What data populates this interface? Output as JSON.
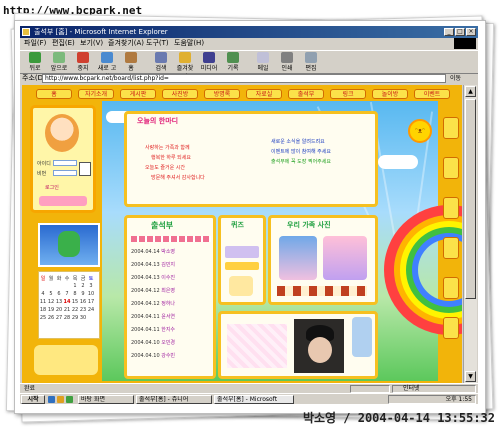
{
  "watermark_top": "http://www.bcpark.net",
  "watermark_bottom": "박소영 / 2004-04-14 13:55:32",
  "window": {
    "title": "출석부 [홈] - Microsoft Internet Explorer",
    "menu": [
      "파일(F)",
      "편집(E)",
      "보기(V)",
      "즐겨찾기(A)",
      "도구(T)",
      "도움말(H)"
    ],
    "toolbar": [
      "뒤로",
      "앞으로",
      "중지",
      "새로 고침",
      "홈",
      "검색",
      "즐겨찾기",
      "미디어",
      "기록",
      "메일",
      "인쇄",
      "편집"
    ],
    "address_label": "주소(D)",
    "address_value": "http://www.bcpark.net/board/list.php?id=",
    "go_label": "이동",
    "links_label": "연결"
  },
  "page": {
    "nav": [
      "홈",
      "자기소개",
      "게시판",
      "사진방",
      "방명록",
      "자료실",
      "출석부",
      "링크",
      "놀이방",
      "이벤트"
    ],
    "welcome_title": "오늘의 한마디",
    "welcome_lines": [
      "사랑하는 가족과 함께",
      "행복한 하루 되세요",
      "오늘도 즐거운 시간",
      "방문해 주셔서 감사합니다"
    ],
    "notice_lines": [
      "새로운 소식을 알려드려요",
      "이벤트에 많이 참여해 주세요",
      "출석부에 꼭 도장 찍어주세요"
    ],
    "login_id_label": "아이디",
    "login_pw_label": "비번",
    "login_button": "로그인",
    "attendance_title": "출석부",
    "attendance_rows": [
      {
        "date": "2004.04.14",
        "name": "박소영"
      },
      {
        "date": "2004.04.13",
        "name": "김민지"
      },
      {
        "date": "2004.04.13",
        "name": "이수진"
      },
      {
        "date": "2004.04.12",
        "name": "최은영"
      },
      {
        "date": "2004.04.12",
        "name": "정하나"
      },
      {
        "date": "2004.04.11",
        "name": "윤서연"
      },
      {
        "date": "2004.04.11",
        "name": "한지수"
      },
      {
        "date": "2004.04.10",
        "name": "오민경"
      },
      {
        "date": "2004.04.10",
        "name": "강수빈"
      }
    ],
    "poll_title": "퀴즈",
    "family_title": "우리 가족 사진",
    "calendar_header": [
      "일",
      "월",
      "화",
      "수",
      "목",
      "금",
      "토"
    ],
    "calendar_days": [
      "",
      "",
      "",
      "",
      "1",
      "2",
      "3",
      "4",
      "5",
      "6",
      "7",
      "8",
      "9",
      "10",
      "11",
      "12",
      "13",
      "14",
      "15",
      "16",
      "17",
      "18",
      "19",
      "20",
      "21",
      "22",
      "23",
      "24",
      "25",
      "26",
      "27",
      "28",
      "29",
      "30",
      "",
      ""
    ]
  },
  "status": {
    "text": "완료",
    "zone": "인터넷"
  },
  "taskbar": {
    "start": "시작",
    "tasks": [
      "바탕 화면",
      "출석부[홈] - 쥬니어",
      "출석부[홈] - Microsoft"
    ],
    "clock": "오후 1:55"
  },
  "colors": {
    "frame_orange": "#f2b40a",
    "title_pink": "#e0227a",
    "nav_text": "#c81414",
    "titlebar": "#0a246a"
  }
}
